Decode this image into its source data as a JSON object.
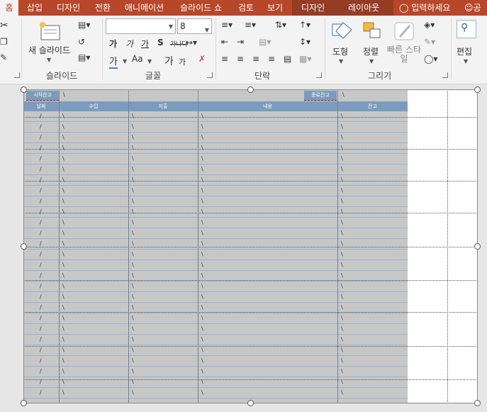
{
  "tabs": [
    {
      "label": "홈",
      "active": true
    },
    {
      "label": "삽입"
    },
    {
      "label": "디자인"
    },
    {
      "label": "전환"
    },
    {
      "label": "애니메이션"
    },
    {
      "label": "슬라이드 쇼"
    },
    {
      "label": "검토"
    },
    {
      "label": "보기"
    },
    {
      "label": "디자인"
    },
    {
      "label": "레이아웃"
    }
  ],
  "tell_me": "입력하세요",
  "share": "공",
  "ribbon": {
    "new_slide": "새 슬라이드",
    "font_name": "",
    "font_size": "8",
    "font_row1": [
      "가",
      "가",
      "가",
      "S",
      "가나다"
    ],
    "font_row2": [
      "가",
      "Aa",
      "가",
      "가"
    ],
    "shapes": "도형",
    "arrange": "정렬",
    "quick_styles": "빠른 스타일",
    "editing": "편집",
    "groups": {
      "slides": "슬라이드",
      "font": "글꼴",
      "paragraph": "단락",
      "drawing": "그리기"
    }
  },
  "table": {
    "start_balance_label": "시작잔고",
    "end_balance_label": "종료잔고",
    "headers": [
      "날짜",
      "수입",
      "지출",
      "내용",
      "잔고"
    ],
    "row_count": 27,
    "date_mark": "/",
    "cell_mark": "\\"
  },
  "colors": {
    "tab_bar": "#b7472a",
    "context_tab": "#953c24",
    "table_header": "#7b9cbe",
    "table_body": "#c7c7c7"
  }
}
